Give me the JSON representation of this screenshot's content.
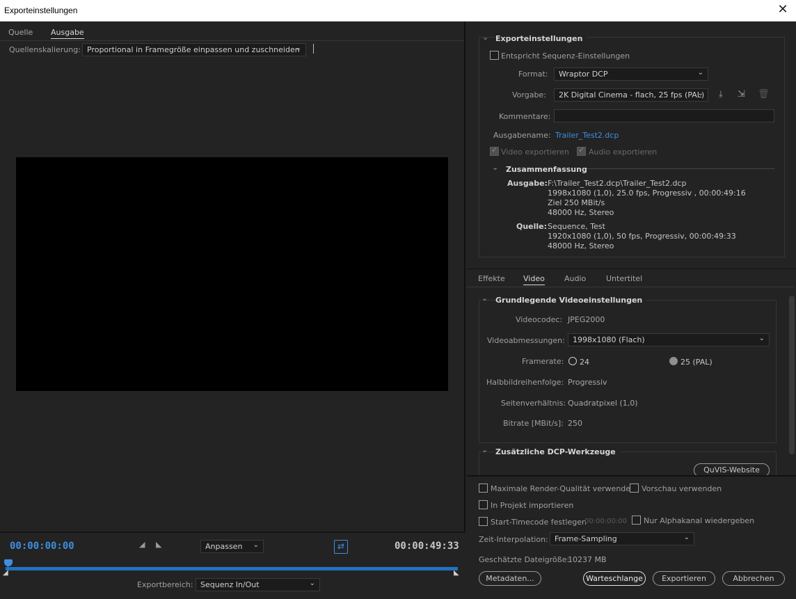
{
  "window": {
    "title": "Exporteinstellungen"
  },
  "left": {
    "tabs": [
      "Quelle",
      "Ausgabe"
    ],
    "scaling_label": "Quellenskalierung:",
    "scaling_value": "Proportional in Framegröße einpassen und zuschneiden",
    "timecode_start": "00:00:00:00",
    "timecode_end": "00:00:49:33",
    "fit_value": "Anpassen",
    "range_label": "Exportbereich:",
    "range_value": "Sequenz In/Out"
  },
  "export": {
    "heading": "Exporteinstellungen",
    "match_seq": "Entspricht Sequenz-Einstellungen",
    "format_label": "Format:",
    "format_value": "Wraptor DCP",
    "preset_label": "Vorgabe:",
    "preset_value": "2K Digital Cinema - flach, 25 fps (PAL)",
    "comment_label": "Kommentare:",
    "output_name_label": "Ausgabename:",
    "output_name": "Trailer_Test2.dcp",
    "export_video": "Video exportieren",
    "export_audio": "Audio exportieren"
  },
  "summary": {
    "heading": "Zusammenfassung",
    "output_label": "Ausgabe:",
    "output_lines": [
      "F:\\Trailer_Test2.dcp\\Trailer_Test2.dcp",
      "1998x1080 (1,0), 25.0 fps, Progressiv , 00:00:49:16",
      "Ziel 250 MBit/s",
      "48000 Hz, Stereo"
    ],
    "source_label": "Quelle:",
    "source_lines": [
      "Sequence, Test",
      "1920x1080 (1,0), 50 fps, Progressiv, 00:00:49:33",
      "48000 Hz, Stereo"
    ]
  },
  "tabs2": [
    "Effekte",
    "Video",
    "Audio",
    "Untertitel"
  ],
  "video": {
    "heading": "Grundlegende Videoeinstellungen",
    "codec_label": "Videocodec:",
    "codec_value": "JPEG2000",
    "dims_label": "Videoabmessungen:",
    "dims_value": "1998x1080 (Flach)",
    "framerate_label": "Framerate:",
    "framerate_opt1": "24",
    "framerate_opt2": "25 (PAL)",
    "field_label": "Halbbildreihenfolge:",
    "field_value": "Progressiv",
    "aspect_label": "Seitenverhältnis:",
    "aspect_value": "Quadratpixel (1,0)",
    "bitrate_label": "Bitrate [MBit/s]:",
    "bitrate_value": "250",
    "dcp_heading": "Zusätzliche DCP-Werkzeuge",
    "dcp_button": "QuVIS-Website"
  },
  "bottom": {
    "max_render": "Maximale Render-Qualität verwenden",
    "use_preview": "Vorschau verwenden",
    "import_project": "In Projekt importieren",
    "start_tc": "Start-Timecode festlegen",
    "start_tc_value": "00:00:00:00",
    "alpha_only": "Nur Alphakanal wiedergeben",
    "interp_label": "Zeit-Interpolation:",
    "interp_value": "Frame-Sampling",
    "filesize_label": "Geschätzte Dateigröße:",
    "filesize_value": "10237 MB",
    "btn_metadata": "Metadaten...",
    "btn_queue": "Warteschlange",
    "btn_export": "Exportieren",
    "btn_cancel": "Abbrechen"
  },
  "colors": {
    "accent": "#3e8fe0",
    "timeline": "#1f72c0",
    "bg": "#232323"
  }
}
